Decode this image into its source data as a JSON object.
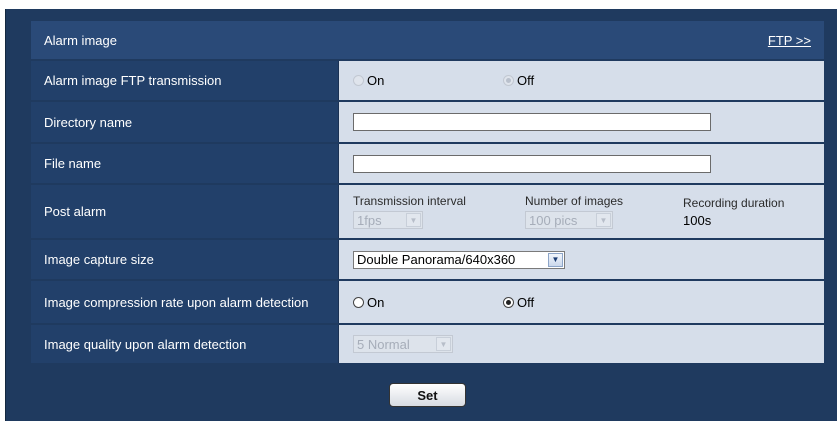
{
  "header": {
    "title": "Alarm image",
    "ftp_link": "FTP >>"
  },
  "rows": {
    "ftp_transmission": {
      "label": "Alarm image FTP transmission",
      "on": "On",
      "off": "Off",
      "selected": "Off",
      "disabled": true
    },
    "directory_name": {
      "label": "Directory name",
      "value": ""
    },
    "file_name": {
      "label": "File name",
      "value": ""
    },
    "post_alarm": {
      "label": "Post alarm",
      "interval_title": "Transmission interval",
      "interval_value": "1fps",
      "images_title": "Number of images",
      "images_value": "100 pics",
      "duration_title": "Recording duration",
      "duration_value": "100s"
    },
    "capture_size": {
      "label": "Image capture size",
      "value": "Double Panorama/640x360"
    },
    "compression": {
      "label": "Image compression rate upon alarm detection",
      "on": "On",
      "off": "Off",
      "selected": "Off"
    },
    "quality": {
      "label": "Image quality upon alarm detection",
      "value": "5 Normal"
    }
  },
  "set_button": "Set",
  "colors": {
    "label_bg": "#22406a",
    "value_bg": "#d6deea",
    "frame_bg": "#1f3a5f"
  },
  "icons": {
    "dropdown": "chevron-down-icon",
    "radio": "radio-icon"
  }
}
